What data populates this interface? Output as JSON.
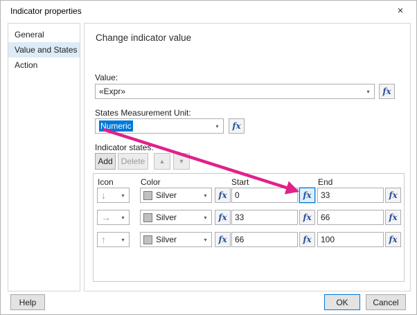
{
  "dialog": {
    "title": "Indicator properties",
    "close_glyph": "×"
  },
  "sidebar": {
    "items": [
      {
        "label": "General"
      },
      {
        "label": "Value and States"
      },
      {
        "label": "Action"
      }
    ]
  },
  "main": {
    "heading": "Change indicator value",
    "value": {
      "label": "Value:",
      "selected": "«Expr»"
    },
    "unit": {
      "label": "States Measurement Unit:",
      "selected": "Numeric"
    },
    "states": {
      "label": "Indicator states:",
      "toolbar": {
        "add": "Add",
        "delete": "Delete",
        "up_glyph": "▲",
        "down_glyph": "▼"
      },
      "headers": {
        "icon": "Icon",
        "color": "Color",
        "start": "Start",
        "end": "End"
      },
      "rows": [
        {
          "icon": "arrow-down",
          "glyph": "↓",
          "color": "Silver",
          "start": "0",
          "end": "33"
        },
        {
          "icon": "arrow-right",
          "glyph": "→",
          "color": "Silver",
          "start": "33",
          "end": "66"
        },
        {
          "icon": "arrow-up",
          "glyph": "↑",
          "color": "Silver",
          "start": "66",
          "end": "100"
        }
      ]
    }
  },
  "footer": {
    "help": "Help",
    "ok": "OK",
    "cancel": "Cancel"
  },
  "fx_label": "fx",
  "chevron_glyph": "▾",
  "colors": {
    "selection_blue": "#0078d7",
    "annotation_pink": "#e0218a",
    "silver_swatch": "#c0c0c0"
  }
}
